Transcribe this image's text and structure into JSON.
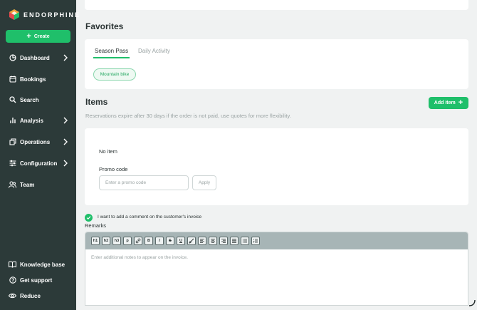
{
  "app": {
    "brand": "ENDORPHINE"
  },
  "sidebar": {
    "create_label": "Create",
    "items": [
      {
        "label": "Dashboard",
        "icon": "dashboard-icon",
        "has_chevron": true
      },
      {
        "label": "Bookings",
        "icon": "calendar-icon",
        "has_chevron": false
      },
      {
        "label": "Search",
        "icon": "search-icon",
        "has_chevron": false
      },
      {
        "label": "Analysis",
        "icon": "bar-chart-icon",
        "has_chevron": true
      },
      {
        "label": "Operations",
        "icon": "operations-icon",
        "has_chevron": true
      },
      {
        "label": "Configuration",
        "icon": "sliders-icon",
        "has_chevron": true
      },
      {
        "label": "Team",
        "icon": "team-icon",
        "has_chevron": false
      }
    ],
    "bottom_items": [
      {
        "label": "Knowledge base",
        "icon": "book-icon"
      },
      {
        "label": "Get support",
        "icon": "help-icon"
      },
      {
        "label": "Reduce",
        "icon": "eye-icon"
      }
    ]
  },
  "favorites": {
    "title": "Favorites",
    "tabs": [
      {
        "label": "Season Pass",
        "active": true
      },
      {
        "label": "Daily Activity",
        "active": false
      }
    ],
    "chips": [
      "Mountain bike"
    ]
  },
  "items": {
    "title": "Items",
    "add_label": "Add item",
    "info": "Reservations expire after 30 days if the order is not paid, use quotes for more flexibility.",
    "empty_text": "No item",
    "promo": {
      "label": "Promo code",
      "placeholder": "Enter a promo code",
      "apply_label": "Apply"
    }
  },
  "comment": {
    "checkbox_label": "I want to add a comment on the customer's invoice",
    "checked": true,
    "remarks_label": "Remarks",
    "placeholder": "Enter additional notes to appear on the invoice.",
    "toolbar": [
      "h1",
      "h2",
      "h3",
      "p"
    ]
  },
  "colors": {
    "sidebar_bg": "#2c3a39",
    "accent": "#1fbf6a",
    "toolbar_bg": "#a7b5b6"
  }
}
